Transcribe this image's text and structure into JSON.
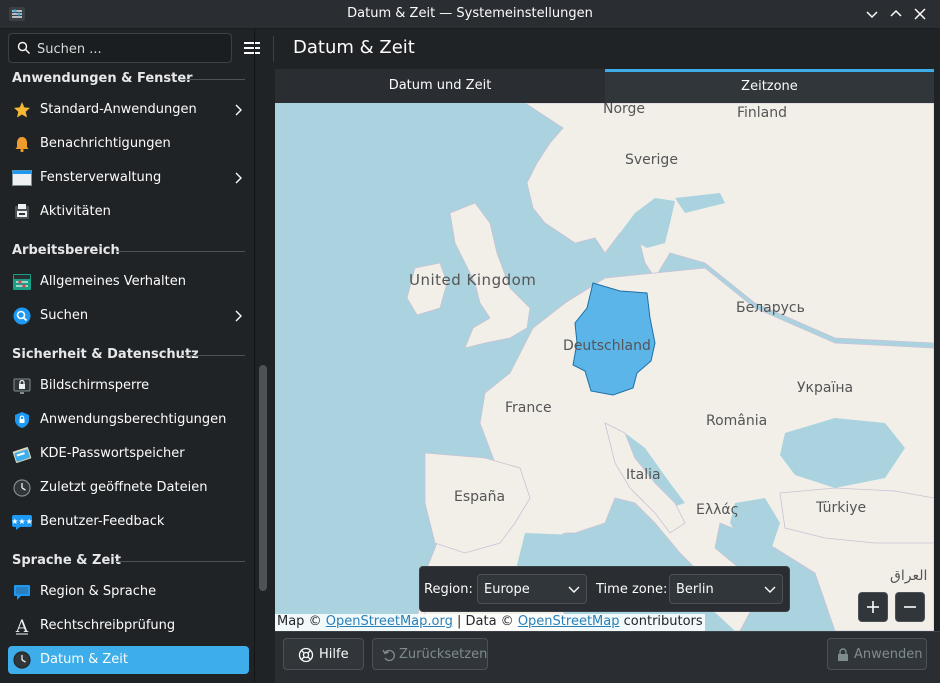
{
  "window": {
    "title": "Datum & Zeit — Systemeinstellungen"
  },
  "search": {
    "placeholder": "Suchen ..."
  },
  "page": {
    "title": "Datum & Zeit"
  },
  "sidebar": {
    "sections": [
      {
        "header": "Anwendungen & Fenster",
        "items": [
          {
            "label": "Standard-Anwendungen",
            "icon": "star-icon",
            "has_children": true
          },
          {
            "label": "Benachrichtigungen",
            "icon": "bell-icon",
            "has_children": false
          },
          {
            "label": "Fensterverwaltung",
            "icon": "window-icon",
            "has_children": true
          },
          {
            "label": "Aktivitäten",
            "icon": "activities-icon",
            "has_children": false
          }
        ]
      },
      {
        "header": "Arbeitsbereich",
        "items": [
          {
            "label": "Allgemeines Verhalten",
            "icon": "behavior-icon",
            "has_children": false
          },
          {
            "label": "Suchen",
            "icon": "search-icon",
            "has_children": true
          }
        ]
      },
      {
        "header": "Sicherheit & Datenschutz",
        "items": [
          {
            "label": "Bildschirmsperre",
            "icon": "screen-lock-icon",
            "has_children": false
          },
          {
            "label": "Anwendungsberechtigungen",
            "icon": "shield-icon",
            "has_children": false
          },
          {
            "label": "KDE-Passwortspeicher",
            "icon": "wallet-icon",
            "has_children": false
          },
          {
            "label": "Zuletzt geöffnete Dateien",
            "icon": "clock-icon",
            "has_children": false
          },
          {
            "label": "Benutzer-Feedback",
            "icon": "feedback-icon",
            "has_children": false
          }
        ]
      },
      {
        "header": "Sprache & Zeit",
        "items": [
          {
            "label": "Region & Sprache",
            "icon": "region-icon",
            "has_children": false
          },
          {
            "label": "Rechtschreibprüfung",
            "icon": "spellcheck-icon",
            "has_children": false
          },
          {
            "label": "Datum & Zeit",
            "icon": "clock-icon",
            "has_children": false,
            "active": true
          }
        ]
      }
    ]
  },
  "tabs": [
    {
      "label": "Datum und Zeit",
      "active": false
    },
    {
      "label": "Zeitzone",
      "active": true
    }
  ],
  "map": {
    "labels": [
      "Norge",
      "Finland",
      "Sverige",
      "United Kingdom",
      "Беларусь",
      "Deutschland",
      "France",
      "Україна",
      "România",
      "Italia",
      "España",
      "Ελλάς",
      "Türkiye",
      "العراق"
    ],
    "highlighted_country": "Deutschland",
    "attribution": {
      "prefix": "Map ©",
      "link1": "OpenStreetMap.org",
      "middle": "| Data ©",
      "link2": "OpenStreetMap",
      "suffix": "contributors"
    },
    "zoom_in": "+",
    "zoom_out": "−"
  },
  "timezone": {
    "region_label": "Region:",
    "region_value": "Europe",
    "tz_label": "Time zone:",
    "tz_value": "Berlin"
  },
  "footer": {
    "help": "Hilfe",
    "reset": "Zurücksetzen",
    "apply": "Anwenden"
  },
  "colors": {
    "accent": "#3daee9",
    "background": "#202326",
    "sea": "#aad3df",
    "land": "#f2efe9",
    "highlight": "#5cb5e8"
  }
}
